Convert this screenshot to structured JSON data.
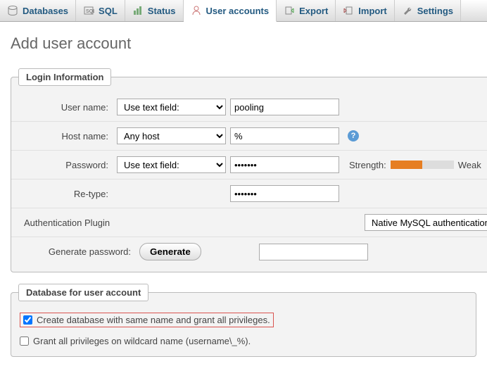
{
  "tabs": {
    "databases": "Databases",
    "sql": "SQL",
    "status": "Status",
    "users": "User accounts",
    "export": "Export",
    "import": "Import",
    "settings": "Settings"
  },
  "heading": "Add user account",
  "login": {
    "legend": "Login Information",
    "username_label": "User name:",
    "username_mode": "Use text field:",
    "username_value": "pooling",
    "hostname_label": "Host name:",
    "hostname_mode": "Any host",
    "hostname_value": "%",
    "password_label": "Password:",
    "password_mode": "Use text field:",
    "password_value": "•••••••",
    "strength_label": "Strength:",
    "strength_text": "Weak",
    "retype_label": "Re-type:",
    "retype_value": "•••••••",
    "auth_label": "Authentication Plugin",
    "auth_value": "Native MySQL authentication",
    "generate_label": "Generate password:",
    "generate_btn": "Generate"
  },
  "db": {
    "legend": "Database for user account",
    "opt1": "Create database with same name and grant all privileges.",
    "opt2": "Grant all privileges on wildcard name (username\\_%)."
  }
}
